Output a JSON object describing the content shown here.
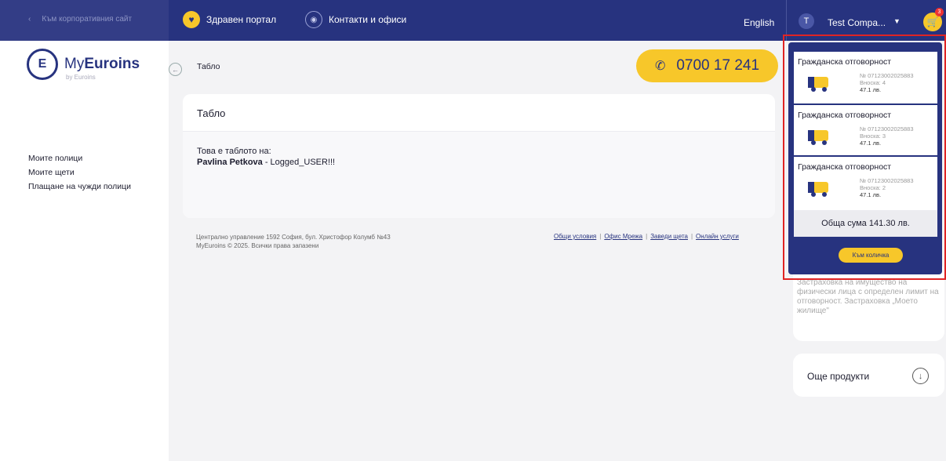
{
  "topbar": {
    "back_link": "Към корпоративния сайт",
    "nav": [
      {
        "label": "Здравен портал",
        "icon": "heart-icon"
      },
      {
        "label": "Контакти и офиси",
        "icon": "location-pin-icon"
      }
    ],
    "language": "English",
    "user": {
      "initial": "T",
      "name": "Test Compa..."
    },
    "cart_count": "3"
  },
  "sidebar": {
    "logo_text_pre": "My",
    "logo_text_bold": "Euroins",
    "logo_sub": "by Euroins",
    "menu": [
      "Моите полици",
      "Моите щети",
      "Плащане на чужди полици"
    ]
  },
  "breadcrumb": "Табло",
  "phone": "0700 17 241",
  "card": {
    "title": "Табло",
    "line1": "Това е таблото на:",
    "user_bold": "Pavlina Petkova",
    "user_rest": " - Logged_USER!!!"
  },
  "footer": {
    "line1": "Централно управление 1592 София, бул. Христофор Колумб №43",
    "line2": "MyEuroins © 2025. Всички права запазени",
    "links": [
      "Общи условия",
      "Офис Мрежа",
      "Заведи щета",
      "Онлайн услуги"
    ]
  },
  "right_card_text": "Застраховка на имущество на физически лица с определен лимит на отговорност. Застраховка „Моето жилище\"",
  "more_products": "Още продукти",
  "cart": {
    "items": [
      {
        "title": "Гражданска отговорност",
        "policy": "№ 07123002025883",
        "installment": "Вноска: 4",
        "price": "47.1 лв."
      },
      {
        "title": "Гражданска отговорност",
        "policy": "№ 07123002025883",
        "installment": "Вноска: 3",
        "price": "47.1 лв."
      },
      {
        "title": "Гражданска отговорност",
        "policy": "№ 07123002025883",
        "installment": "Вноска: 2",
        "price": "47.1 лв."
      }
    ],
    "total": "Обща сума 141.30 лв.",
    "go_button": "Към количка"
  }
}
